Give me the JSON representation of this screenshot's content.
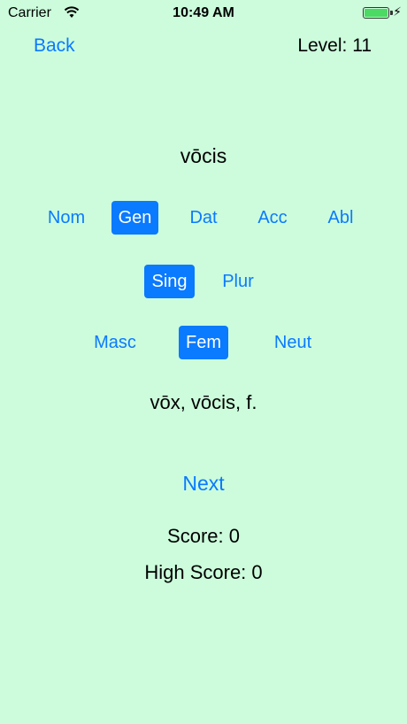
{
  "status": {
    "carrier": "Carrier",
    "time": "10:49 AM"
  },
  "nav": {
    "back_label": "Back",
    "level_label": "Level: 11"
  },
  "question": {
    "word": "vōcis"
  },
  "cases": [
    "Nom",
    "Gen",
    "Dat",
    "Acc",
    "Abl"
  ],
  "selected_case": "Gen",
  "numbers": [
    "Sing",
    "Plur"
  ],
  "selected_number": "Sing",
  "genders": [
    "Masc",
    "Fem",
    "Neut"
  ],
  "selected_gender": "Fem",
  "dictionary_entry": "vōx, vōcis, f.",
  "next_label": "Next",
  "score_label": "Score: 0",
  "high_score_label": "High Score: 0",
  "colors": {
    "background": "#ccfcdc",
    "accent": "#0a7aff",
    "battery": "#4cd964"
  }
}
